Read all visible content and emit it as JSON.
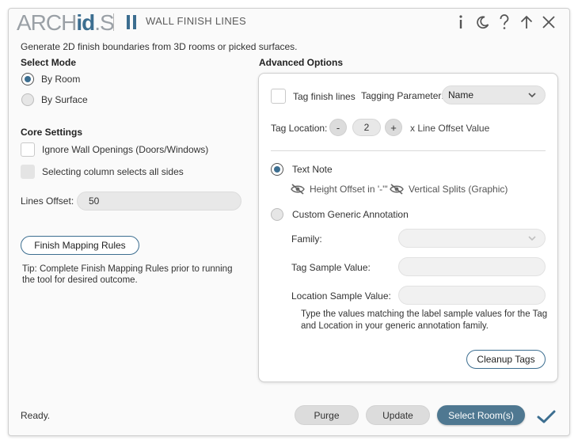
{
  "header": {
    "logo_prefix": "ARCH",
    "logo_id": "id",
    "logo_s": "S",
    "title": "WALL FINISH LINES",
    "icons": [
      "info-icon",
      "moon-icon",
      "help-icon",
      "arrow-up-icon",
      "close-icon"
    ]
  },
  "subtitle": "Generate 2D finish boundaries from 3D rooms or picked surfaces.",
  "select_mode": {
    "title": "Select Mode",
    "options": [
      {
        "label": "By Room",
        "selected": true
      },
      {
        "label": "By Surface",
        "selected": false
      }
    ]
  },
  "core_settings": {
    "title": "Core Settings",
    "ignore_openings": "Ignore Wall Openings (Doors/Windows)",
    "column_sides": "Selecting column selects all sides",
    "lines_offset_label": "Lines Offset:",
    "lines_offset_value": "50"
  },
  "finish_mapping_button": "Finish Mapping Rules",
  "tip": "Tip: Complete Finish Mapping Rules prior to running the tool for desired outcome.",
  "advanced": {
    "title": "Advanced Options",
    "tag_finish_lines": "Tag finish lines",
    "tagging_parameter_label": "Tagging Parameter:",
    "tagging_parameter_value": "Name",
    "tag_location_label": "Tag Location:",
    "stepper_minus": "-",
    "stepper_value": "2",
    "stepper_plus": "+",
    "stepper_suffix": "x Line Offset Value",
    "text_note": "Text Note",
    "height_offset": "Height Offset in '-'\"",
    "vertical_splits": "Vertical Splits (Graphic)",
    "custom_annotation": "Custom Generic Annotation",
    "family_label": "Family:",
    "tag_sample_label": "Tag Sample Value:",
    "location_sample_label": "Location Sample Value:",
    "note": "Type the values matching the label sample values for the Tag and Location in your generic annotation family.",
    "cleanup_button": "Cleanup Tags"
  },
  "footer": {
    "status": "Ready.",
    "purge": "Purge",
    "update": "Update",
    "select_rooms": "Select Room(s)"
  },
  "colors": {
    "accent": "#3c6e90",
    "primary_button": "#4f7891"
  }
}
